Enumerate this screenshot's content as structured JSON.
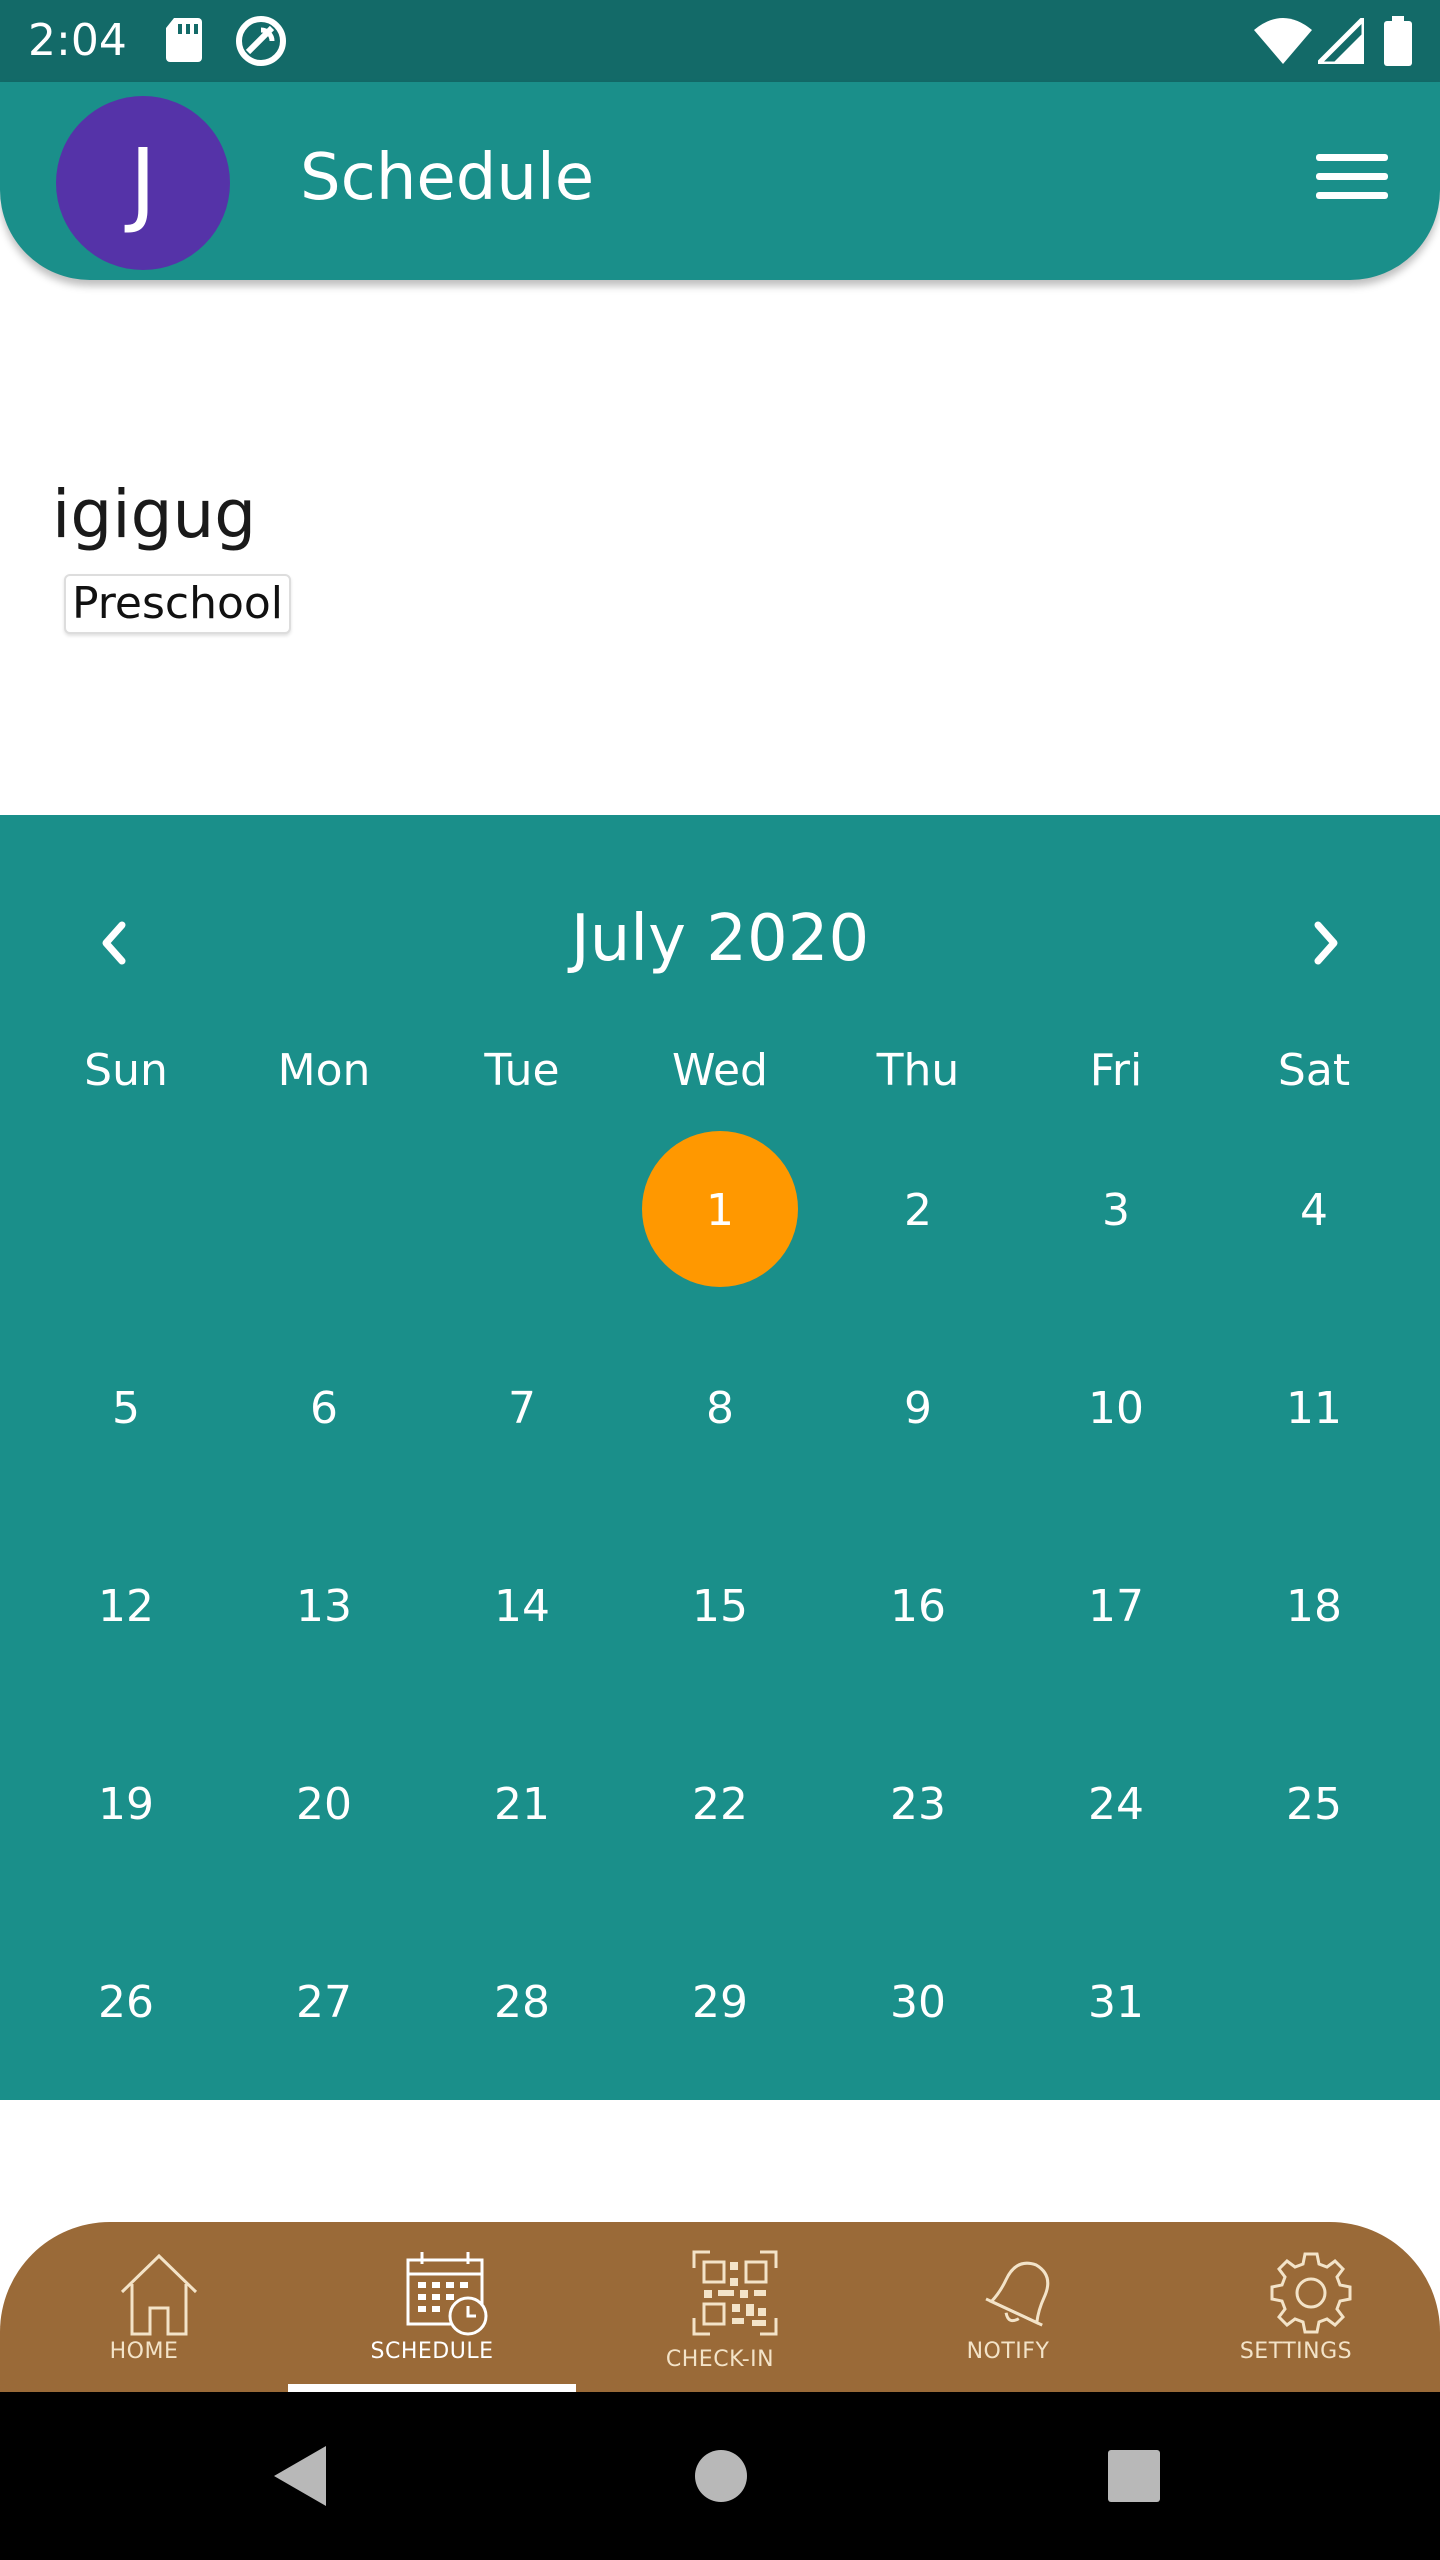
{
  "status_bar": {
    "time": "2:04",
    "icons": [
      "sd-card-icon",
      "sync-icon",
      "wifi-icon",
      "signal-icon",
      "battery-icon"
    ]
  },
  "header": {
    "avatar_initial": "J",
    "title": "Schedule",
    "menu_icon": "hamburger-menu-icon",
    "background": "#1a8f8a",
    "avatar_color": "#5533a8"
  },
  "profile": {
    "name": "igigug",
    "class_label": "Preschool"
  },
  "calendar": {
    "month_title": "July 2020",
    "weekdays": [
      "Sun",
      "Mon",
      "Tue",
      "Wed",
      "Thu",
      "Fri",
      "Sat"
    ],
    "selected_day": "1",
    "selected_color": "#ff9800",
    "weeks": [
      [
        "",
        "",
        "",
        "1",
        "2",
        "3",
        "4"
      ],
      [
        "5",
        "6",
        "7",
        "8",
        "9",
        "10",
        "11"
      ],
      [
        "12",
        "13",
        "14",
        "15",
        "16",
        "17",
        "18"
      ],
      [
        "19",
        "20",
        "21",
        "22",
        "23",
        "24",
        "25"
      ],
      [
        "26",
        "27",
        "28",
        "29",
        "30",
        "31",
        ""
      ]
    ]
  },
  "bottom_nav": {
    "background": "#9a6a38",
    "active": "SCHEDULE",
    "items": [
      {
        "label": "HOME",
        "icon": "home-icon"
      },
      {
        "label": "SCHEDULE",
        "icon": "calendar-clock-icon"
      },
      {
        "label": "CHECK-IN",
        "icon": "qr-code-icon"
      },
      {
        "label": "NOTIFY",
        "icon": "bell-icon"
      },
      {
        "label": "SETTINGS",
        "icon": "gear-icon"
      }
    ]
  },
  "system_nav": {
    "icons": [
      "back-icon",
      "home-circle-icon",
      "recents-icon"
    ]
  }
}
